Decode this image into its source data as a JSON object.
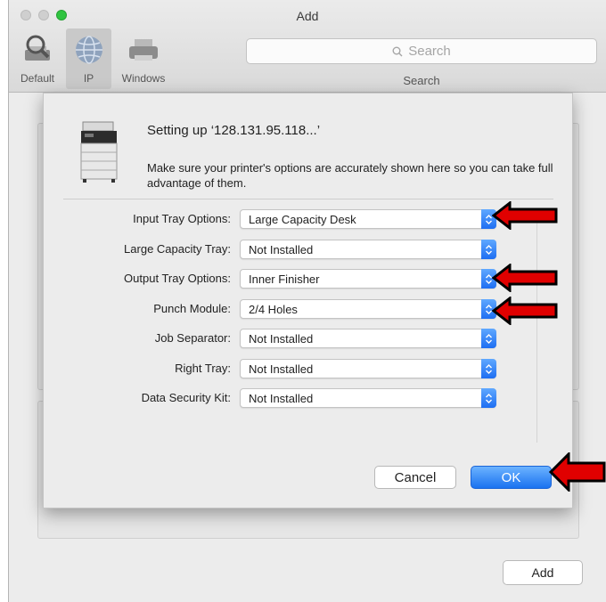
{
  "window": {
    "title": "Add"
  },
  "toolbar": {
    "items": [
      {
        "label": "Default",
        "icon": "default-printer-icon"
      },
      {
        "label": "IP",
        "icon": "globe-icon"
      },
      {
        "label": "Windows",
        "icon": "windows-printer-icon"
      }
    ],
    "search_placeholder": "Search",
    "search_label": "Search"
  },
  "sheet": {
    "title": "Setting up ‘128.131.95.118...’",
    "description": "Make sure your printer's options are accurately shown here so you can take full advantage of them.",
    "options": [
      {
        "label": "Input Tray Options:",
        "value": "Large Capacity Desk"
      },
      {
        "label": "Large Capacity Tray:",
        "value": "Not Installed"
      },
      {
        "label": "Output Tray Options:",
        "value": "Inner Finisher"
      },
      {
        "label": "Punch Module:",
        "value": "2/4 Holes"
      },
      {
        "label": "Job Separator:",
        "value": "Not Installed"
      },
      {
        "label": "Right Tray:",
        "value": "Not Installed"
      },
      {
        "label": "Data Security Kit:",
        "value": "Not Installed"
      }
    ],
    "cancel_label": "Cancel",
    "ok_label": "OK"
  },
  "footer": {
    "add_label": "Add"
  },
  "colors": {
    "accent": "#1a72f0",
    "annotation_arrow": "#e00000"
  }
}
